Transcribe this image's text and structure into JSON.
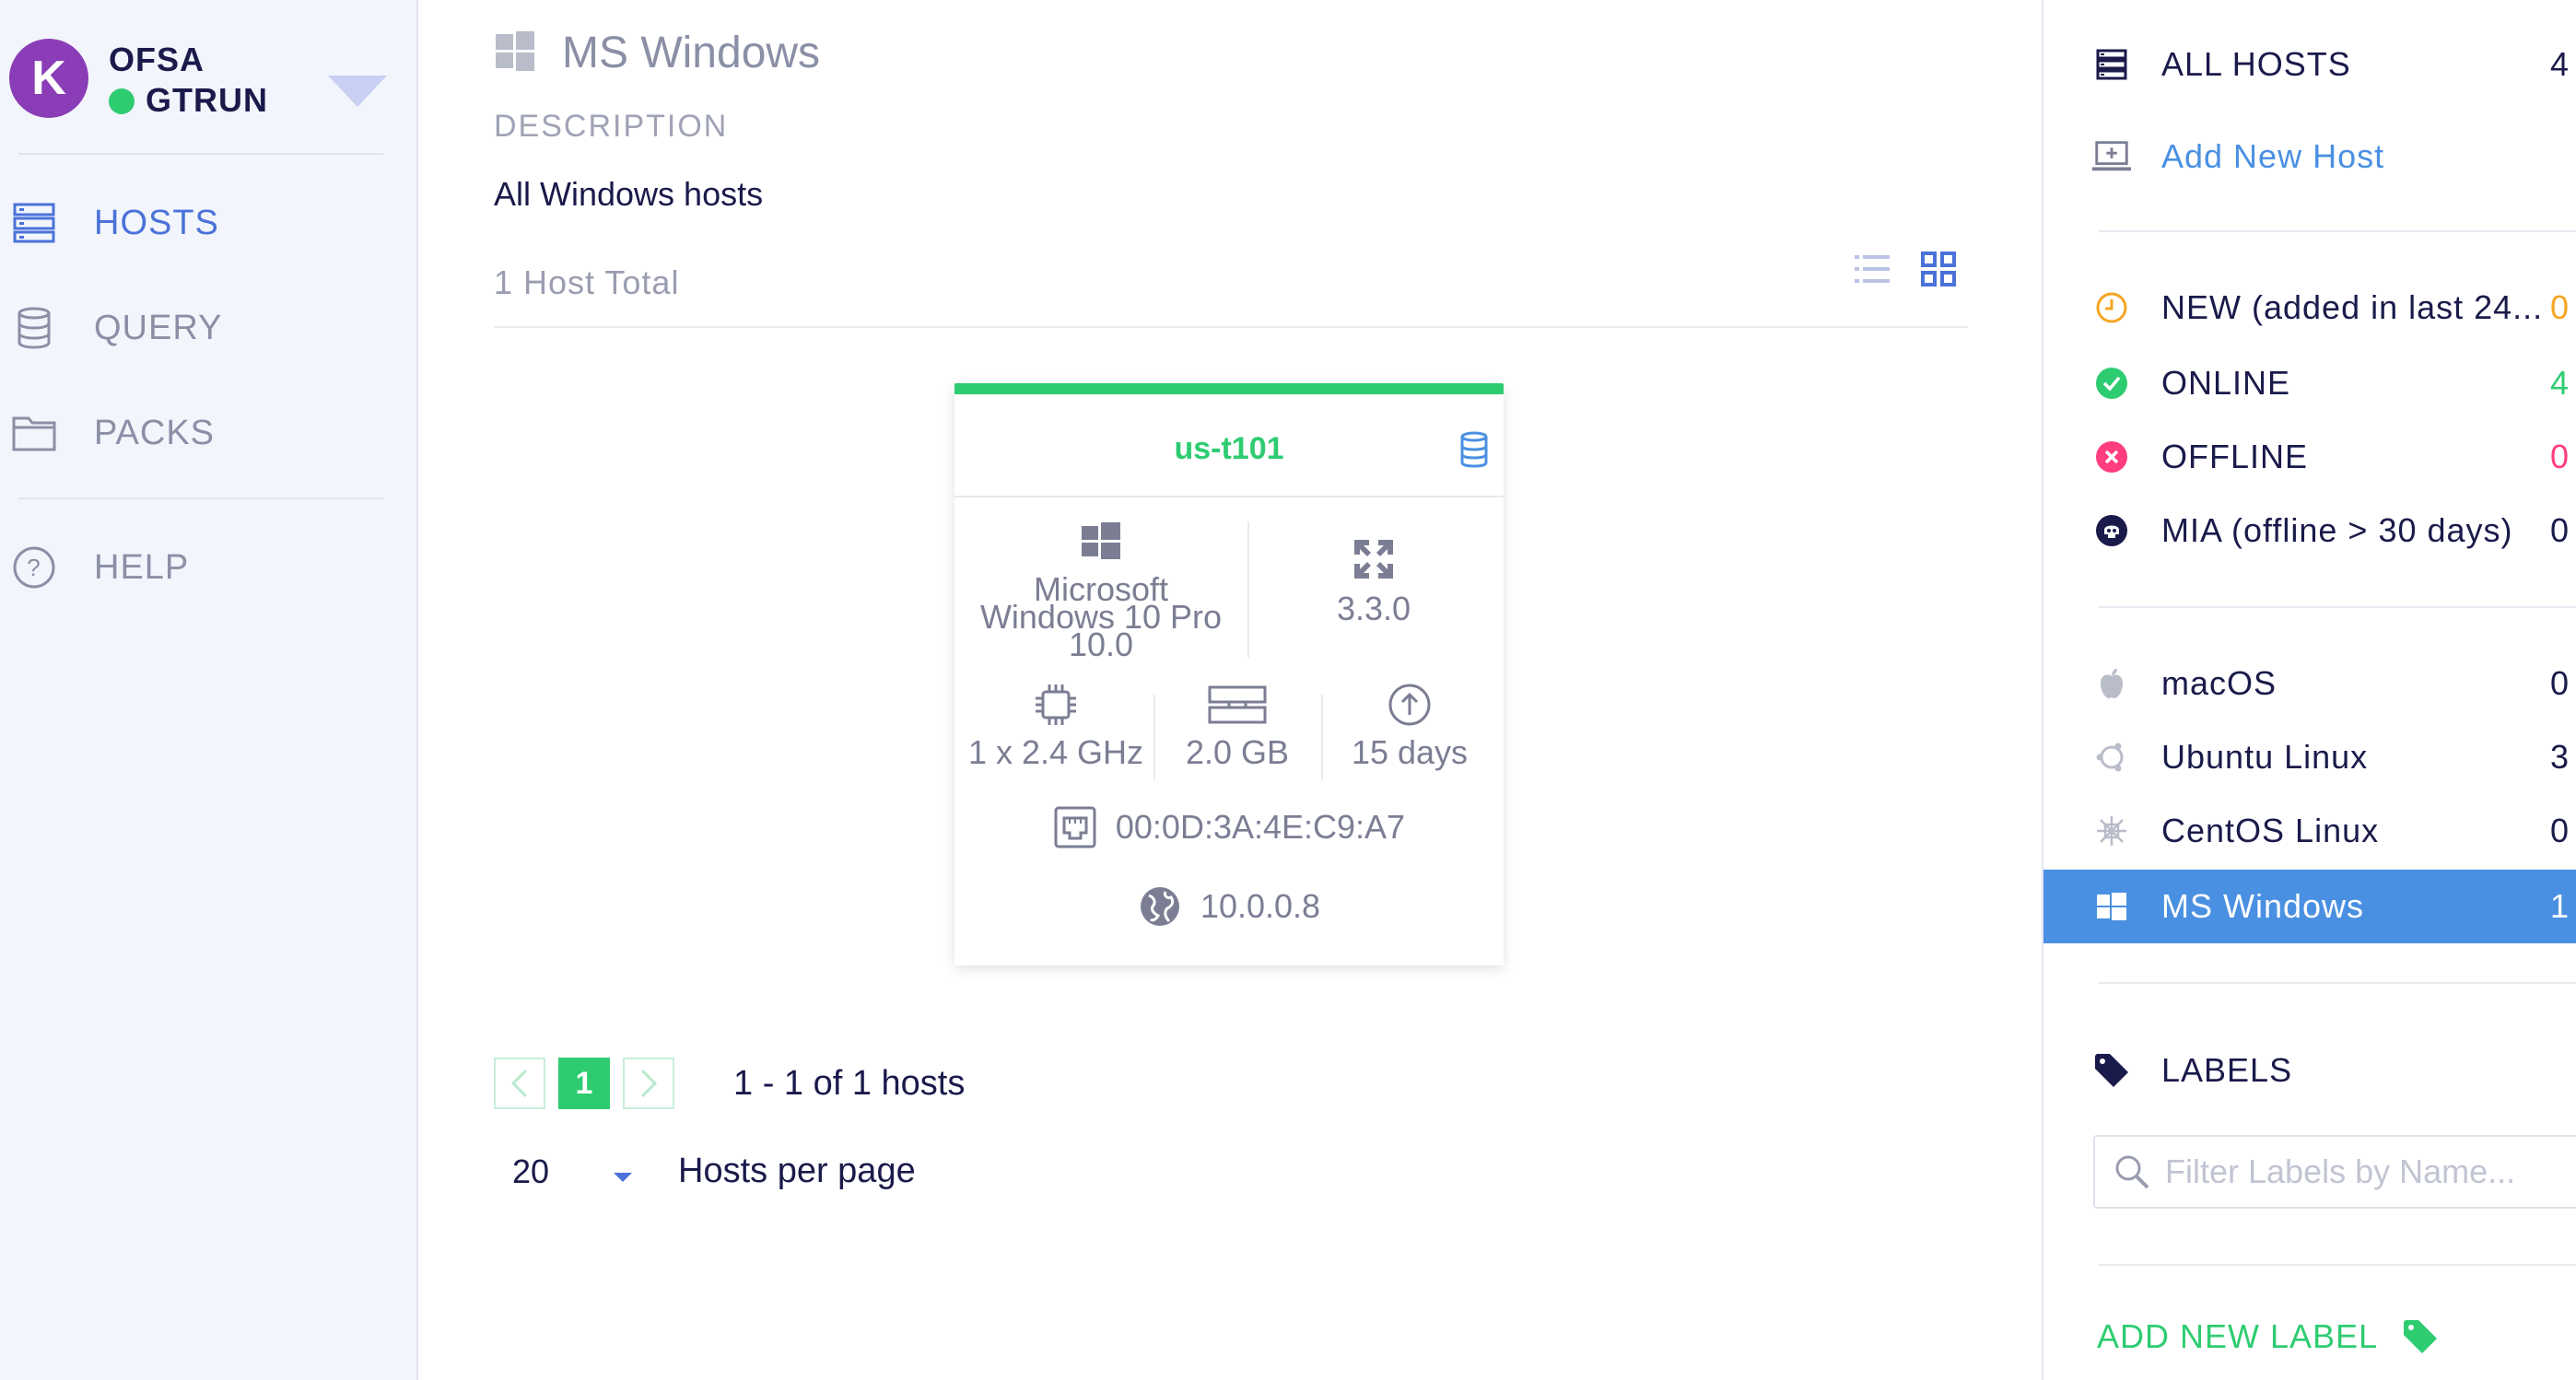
{
  "app": {
    "org": "OFSA",
    "user": "GTRUN",
    "logo_letter": "K",
    "colors": {
      "accent": "#4a72d8",
      "green": "#2ecc71",
      "purple": "#8a3db6",
      "active_row": "#4a90e2"
    }
  },
  "nav": {
    "items": [
      {
        "label": "HOSTS",
        "icon": "hosts-icon",
        "active": true
      },
      {
        "label": "QUERY",
        "icon": "database-icon",
        "active": false
      },
      {
        "label": "PACKS",
        "icon": "folder-icon",
        "active": false
      },
      {
        "label": "HELP",
        "icon": "help-icon",
        "active": false
      }
    ]
  },
  "main": {
    "title": "MS Windows",
    "description_label": "DESCRIPTION",
    "description": "All Windows hosts",
    "total": "1 Host Total",
    "host_card": {
      "name": "us-t101",
      "os_line1": "Microsoft",
      "os_line2": "Windows 10 Pro",
      "os_line3": "10.0",
      "osquery_version": "3.3.0",
      "cpu": "1 x 2.4 GHz",
      "memory": "2.0 GB",
      "uptime": "15 days",
      "mac": "00:0D:3A:4E:C9:A7",
      "ip": "10.0.0.8",
      "status": "online"
    },
    "pagination": {
      "current_page": "1",
      "info": "1 - 1 of 1 hosts",
      "per_page_value": "20",
      "per_page_label": "Hosts per page"
    }
  },
  "side": {
    "all_hosts": {
      "label": "ALL HOSTS",
      "count": "4"
    },
    "add_host": "Add New Host",
    "status": [
      {
        "label": "NEW (added in last 24...",
        "count": "0",
        "color": "#f5a623",
        "icon": "clock-icon"
      },
      {
        "label": "ONLINE",
        "count": "4",
        "color": "#2ecc71",
        "icon": "check-circle-icon"
      },
      {
        "label": "OFFLINE",
        "count": "0",
        "color": "#ff3d7f",
        "icon": "x-circle-icon"
      },
      {
        "label": "MIA (offline > 30 days)",
        "count": "0",
        "color": "#1a1a4b",
        "icon": "skull-icon"
      }
    ],
    "platforms": [
      {
        "label": "macOS",
        "count": "0",
        "icon": "apple-icon"
      },
      {
        "label": "Ubuntu Linux",
        "count": "3",
        "icon": "ubuntu-icon"
      },
      {
        "label": "CentOS Linux",
        "count": "0",
        "icon": "centos-icon"
      },
      {
        "label": "MS Windows",
        "count": "1",
        "icon": "windows-icon",
        "active": true
      }
    ],
    "labels_heading": "LABELS",
    "filter_placeholder": "Filter Labels by Name...",
    "add_label": "ADD NEW LABEL"
  }
}
